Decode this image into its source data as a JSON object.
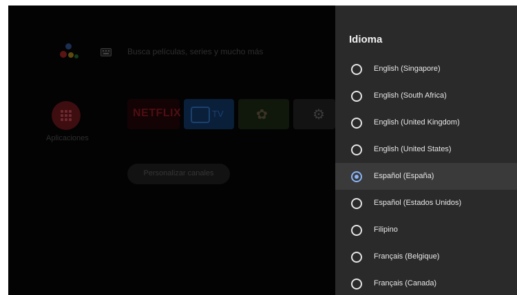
{
  "home": {
    "search_hint": "Busca películas, series y mucho más",
    "apps_label": "Aplicaciones",
    "tiles": {
      "netflix": "NETFLIX",
      "tv": "TV"
    },
    "customize_channels": "Personalizar canales"
  },
  "panel": {
    "title": "Idioma",
    "languages": [
      {
        "label": "English (Singapore)",
        "selected": false
      },
      {
        "label": "English (South Africa)",
        "selected": false
      },
      {
        "label": "English (United Kingdom)",
        "selected": false
      },
      {
        "label": "English (United States)",
        "selected": false
      },
      {
        "label": "Español (España)",
        "selected": true
      },
      {
        "label": "Español (Estados Unidos)",
        "selected": false
      },
      {
        "label": "Filipino",
        "selected": false
      },
      {
        "label": "Français (Belgique)",
        "selected": false
      },
      {
        "label": "Français (Canada)",
        "selected": false
      }
    ]
  },
  "colors": {
    "panel_bg": "#2a2a2a",
    "accent": "#8ab4f8",
    "home_bg": "#030303"
  },
  "icons": [
    "google-assistant-icon",
    "keyboard-icon",
    "apps-grid-icon",
    "tv-icon",
    "settings-gear-icon",
    "radio-button-icon"
  ]
}
